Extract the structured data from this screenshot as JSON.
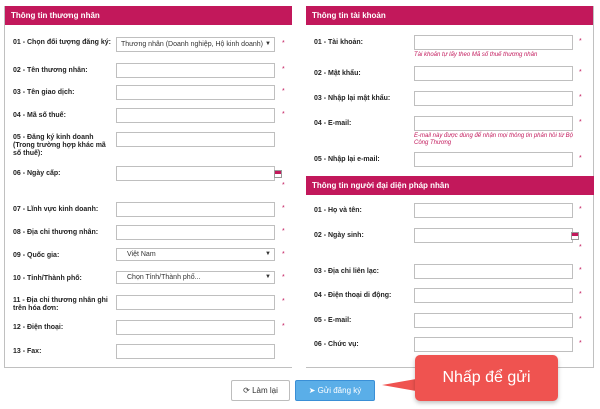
{
  "left_section": {
    "title": "Thông tin thương nhân",
    "fields": [
      {
        "label": "01 - Chọn đối tượng đăng ký:",
        "type": "select",
        "value": "Thương nhân (Doanh nghiệp, Hộ kinh doanh)"
      },
      {
        "label": "02 - Tên thương nhân:",
        "type": "text",
        "value": ""
      },
      {
        "label": "03 - Tên giao dịch:",
        "type": "text",
        "value": ""
      },
      {
        "label": "04 - Mã số thuế:",
        "type": "text",
        "value": ""
      },
      {
        "label": "05 - Đăng ký kinh doanh (Trong trường hợp khác mã số thuế):",
        "type": "text",
        "value": ""
      },
      {
        "label": "06 - Ngày cấp:",
        "type": "date",
        "value": ""
      },
      {
        "label": "07 - Lĩnh vực kinh doanh:",
        "type": "text",
        "value": ""
      },
      {
        "label": "08 - Địa chỉ thương nhân:",
        "type": "text",
        "value": ""
      },
      {
        "label": "09 - Quốc gia:",
        "type": "select",
        "value": "Việt Nam"
      },
      {
        "label": "10 - Tỉnh/Thành phố:",
        "type": "select",
        "value": "Chọn Tỉnh/Thành phố..."
      },
      {
        "label": "11 - Địa chỉ thương nhân ghi trên hóa đơn:",
        "type": "text",
        "value": ""
      },
      {
        "label": "12 - Điện thoại:",
        "type": "text",
        "value": ""
      },
      {
        "label": "13 - Fax:",
        "type": "text",
        "value": ""
      }
    ]
  },
  "account_section": {
    "title": "Thông tin tài khoản",
    "fields": [
      {
        "label": "01 - Tài khoản:",
        "type": "text",
        "value": "",
        "hint": "Tài khoản tự lấy theo Mã số thuế thương nhân"
      },
      {
        "label": "02 - Mật khẩu:",
        "type": "password",
        "value": ""
      },
      {
        "label": "03 - Nhập lại mật khẩu:",
        "type": "password",
        "value": ""
      },
      {
        "label": "04 - E-mail:",
        "type": "text",
        "value": "",
        "hint": "E-mail này được dùng để nhận mọi thông tin phản hồi từ Bộ Công Thương"
      },
      {
        "label": "05 - Nhập lại e-mail:",
        "type": "text",
        "value": ""
      }
    ]
  },
  "rep_section": {
    "title": "Thông tin người đại diện pháp nhân",
    "fields": [
      {
        "label": "01 - Họ và tên:",
        "type": "text",
        "value": ""
      },
      {
        "label": "02 - Ngày sinh:",
        "type": "date",
        "value": ""
      },
      {
        "label": "03 - Địa chỉ liên lạc:",
        "type": "text",
        "value": ""
      },
      {
        "label": "04 - Điện thoại di động:",
        "type": "text",
        "value": ""
      },
      {
        "label": "05 - E-mail:",
        "type": "text",
        "value": ""
      },
      {
        "label": "06 - Chức vụ:",
        "type": "text",
        "value": ""
      }
    ]
  },
  "required_mark": "*",
  "buttons": {
    "reset_label": "Làm lại",
    "submit_label": "Gửi đăng ký"
  },
  "callout": {
    "text": "Nhấp để gửi"
  },
  "colors": {
    "section_header": "#c2185b",
    "submit_button": "#5aaee8",
    "callout": "#ef5350"
  }
}
